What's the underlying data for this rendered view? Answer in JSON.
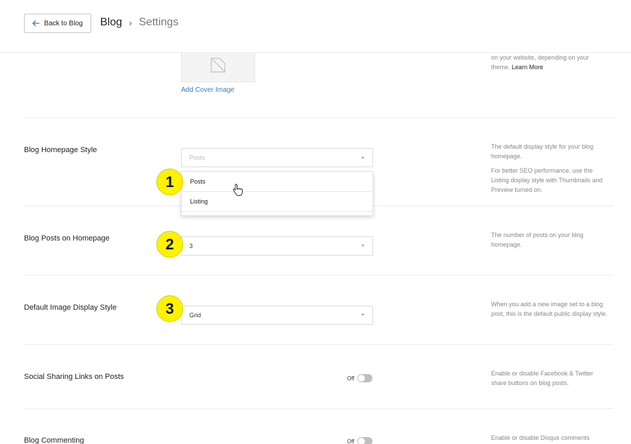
{
  "header": {
    "back_label": "Back to Blog",
    "breadcrumb_blog": "Blog",
    "breadcrumb_sep": "›",
    "breadcrumb_current": "Settings"
  },
  "cover": {
    "help_text": "represents this page. It may be displayed on your website, depending on your theme.",
    "help_link": "Learn More",
    "add_link": "Add Cover Image"
  },
  "homepage_style": {
    "label": "Blog Homepage Style",
    "selected": "Posts",
    "options": [
      "Posts",
      "Listing"
    ],
    "help_1": "The default display style for your blog homepage.",
    "help_2": "For better SEO performance, use the Listing display style with Thumbnails and Preview turned on."
  },
  "posts_on_homepage": {
    "label": "Blog Posts on Homepage",
    "value": "3",
    "help": "The number of posts on your blog homepage."
  },
  "image_display": {
    "label": "Default Image Display Style",
    "value": "Grid",
    "help": "When you add a new image set to a blog post, this is the default public display style."
  },
  "social_sharing": {
    "label": "Social Sharing Links on Posts",
    "state": "Off",
    "help": "Enable or disable Facebook & Twitter share buttons on blog posts."
  },
  "commenting": {
    "label": "Blog Commenting",
    "state": "Off",
    "help": "Enable or disable Disqus comments"
  },
  "badges": [
    "1",
    "2",
    "3"
  ],
  "colors": {
    "accent_link": "#3b7bbf",
    "badge": "#fff200",
    "toggle_off": "#bfbfbf"
  }
}
